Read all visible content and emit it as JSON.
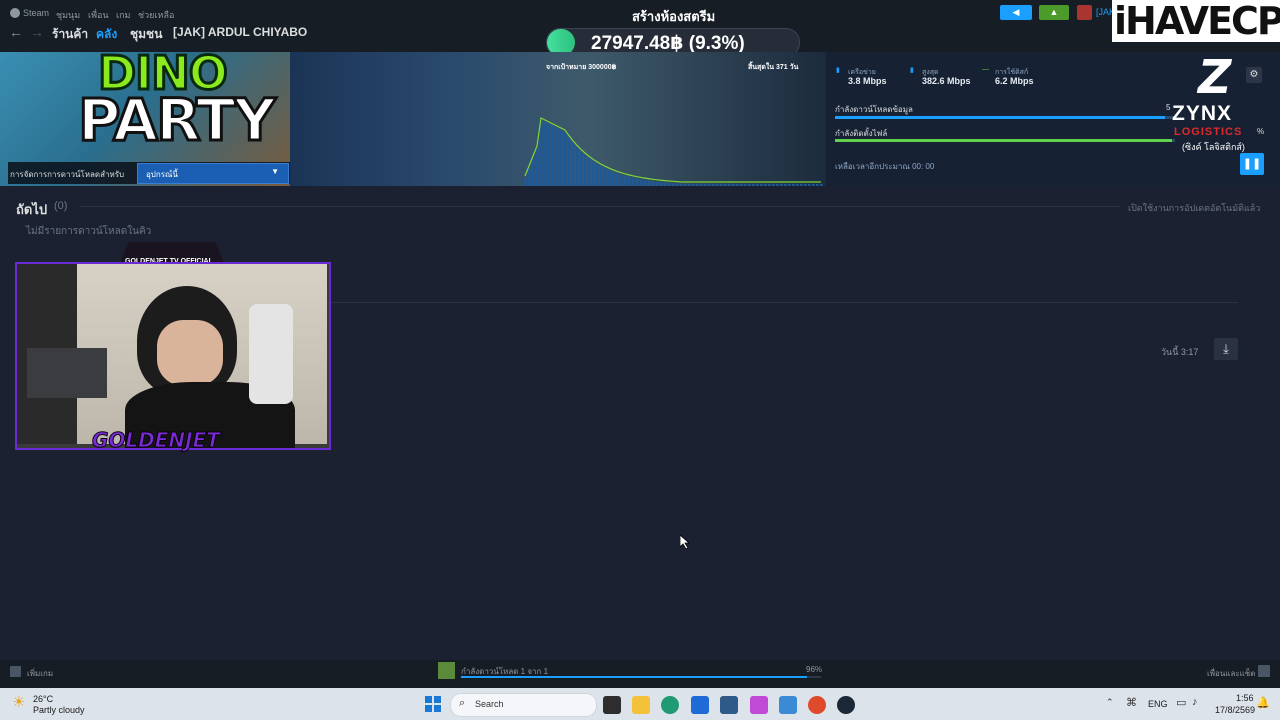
{
  "topbar": {
    "menu": [
      "Steam",
      "ชุมนุม",
      "เพื่อน",
      "เกม",
      "ช่วยเหลือ"
    ],
    "nav": [
      "ร้านค้า",
      "คลัง",
      "ชุมชน",
      "[JAK] ARDUL CHIYABO"
    ],
    "nav_active_index": 1,
    "account_label": "[JAK",
    "brand_logo": "iHAVECPU"
  },
  "stream_overlay": {
    "title": "สร้างห้องสตรีม",
    "donation_amount": "27947.48฿ (9.3%)",
    "donation_progress": 0.093,
    "goal_label": "จากเป้าหมาย 300000฿",
    "days_left": "สิ้นสุดใน 371 วัน"
  },
  "banner": {
    "game_title_line1": "DINO",
    "game_title_line2": "PARTY",
    "download_manage_label": "การจัดการการดาวน์โหลดสำหรับ",
    "device_select_value": "อุปกรณ์นี้"
  },
  "stats": {
    "network_label": "เครือข่าย",
    "network_value": "3.8 Mbps",
    "peak_label": "สูงสุด",
    "peak_value": "382.6 Mbps",
    "disk_label": "การใช้ดิสก์",
    "disk_value": "6.2 Mbps",
    "downloading_label": "กำลังดาวน์โหลดข้อมูล",
    "downloading_prefix": "5",
    "installing_label": "กำลังติดตั้งไฟล์",
    "installing_suffix": "%",
    "downloading_progress": 0.97,
    "installing_progress": 0.99,
    "time_left_label": "เหลือเวลาอีกประมาณ 00: 00",
    "sponsor_name": "ZYNX",
    "sponsor_sub": "LOGISTICS",
    "sponsor_thai": "(ซิงค์ โลจิสติกส์)"
  },
  "queue": {
    "title": "ถัดไป",
    "count": "(0)",
    "empty_text": "ไม่มีรายการดาวน์โหลดในคิว",
    "auto_update_text": "เปิดใช้งานการอัปเดตอัตโนมัติแล้ว"
  },
  "webcam": {
    "channel_label": "GOLDENJET TV OFFICIAL",
    "streamer_name": "GOLDENJET"
  },
  "scheduled": {
    "time_text": "วันนี้ 3:17"
  },
  "footer": {
    "add_game": "เพิ่มเกม",
    "download_status": "กำลังดาวน์โหลด 1 จาก 1",
    "download_percent": "96%",
    "download_progress": 0.96,
    "friends_chat": "เพื่อนและแช็ต"
  },
  "taskbar": {
    "temperature": "26°C",
    "weather": "Partly cloudy",
    "search_placeholder": "Search",
    "language": "ENG",
    "time": "1:56",
    "date": "17/8/2569"
  },
  "colors": {
    "accent": "#1a9fff",
    "progress_green": "#5fd14a",
    "frame_purple": "#6a2bd6"
  }
}
